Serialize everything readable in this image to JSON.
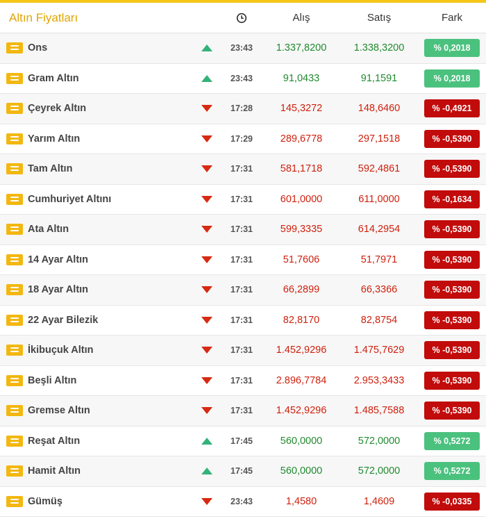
{
  "header": {
    "title": "Altın Fiyatları",
    "clock_icon": "clock-icon",
    "alis_label": "Alış",
    "satis_label": "Satış",
    "fark_label": "Fark"
  },
  "colors": {
    "accent": "#f5c518",
    "up": "#4bc17e",
    "down": "#c20b0b"
  },
  "rows": [
    {
      "name": "Ons",
      "direction": "up",
      "time": "23:43",
      "alis": "1.337,8200",
      "satis": "1.338,3200",
      "fark": "% 0,2018"
    },
    {
      "name": "Gram Altın",
      "direction": "up",
      "time": "23:43",
      "alis": "91,0433",
      "satis": "91,1591",
      "fark": "% 0,2018"
    },
    {
      "name": "Çeyrek Altın",
      "direction": "down",
      "time": "17:28",
      "alis": "145,3272",
      "satis": "148,6460",
      "fark": "% -0,4921"
    },
    {
      "name": "Yarım Altın",
      "direction": "down",
      "time": "17:29",
      "alis": "289,6778",
      "satis": "297,1518",
      "fark": "% -0,5390"
    },
    {
      "name": "Tam Altın",
      "direction": "down",
      "time": "17:31",
      "alis": "581,1718",
      "satis": "592,4861",
      "fark": "% -0,5390"
    },
    {
      "name": "Cumhuriyet Altını",
      "direction": "down",
      "time": "17:31",
      "alis": "601,0000",
      "satis": "611,0000",
      "fark": "% -0,1634"
    },
    {
      "name": "Ata Altın",
      "direction": "down",
      "time": "17:31",
      "alis": "599,3335",
      "satis": "614,2954",
      "fark": "% -0,5390"
    },
    {
      "name": "14 Ayar Altın",
      "direction": "down",
      "time": "17:31",
      "alis": "51,7606",
      "satis": "51,7971",
      "fark": "% -0,5390"
    },
    {
      "name": "18 Ayar Altın",
      "direction": "down",
      "time": "17:31",
      "alis": "66,2899",
      "satis": "66,3366",
      "fark": "% -0,5390"
    },
    {
      "name": "22 Ayar Bilezik",
      "direction": "down",
      "time": "17:31",
      "alis": "82,8170",
      "satis": "82,8754",
      "fark": "% -0,5390"
    },
    {
      "name": "İkibuçuk Altın",
      "direction": "down",
      "time": "17:31",
      "alis": "1.452,9296",
      "satis": "1.475,7629",
      "fark": "% -0,5390"
    },
    {
      "name": "Beşli Altın",
      "direction": "down",
      "time": "17:31",
      "alis": "2.896,7784",
      "satis": "2.953,3433",
      "fark": "% -0,5390"
    },
    {
      "name": "Gremse Altın",
      "direction": "down",
      "time": "17:31",
      "alis": "1.452,9296",
      "satis": "1.485,7588",
      "fark": "% -0,5390"
    },
    {
      "name": "Reşat Altın",
      "direction": "up",
      "time": "17:45",
      "alis": "560,0000",
      "satis": "572,0000",
      "fark": "% 0,5272"
    },
    {
      "name": "Hamit Altın",
      "direction": "up",
      "time": "17:45",
      "alis": "560,0000",
      "satis": "572,0000",
      "fark": "% 0,5272"
    },
    {
      "name": "Gümüş",
      "direction": "down",
      "time": "23:43",
      "alis": "1,4580",
      "satis": "1,4609",
      "fark": "% -0,0335"
    }
  ]
}
